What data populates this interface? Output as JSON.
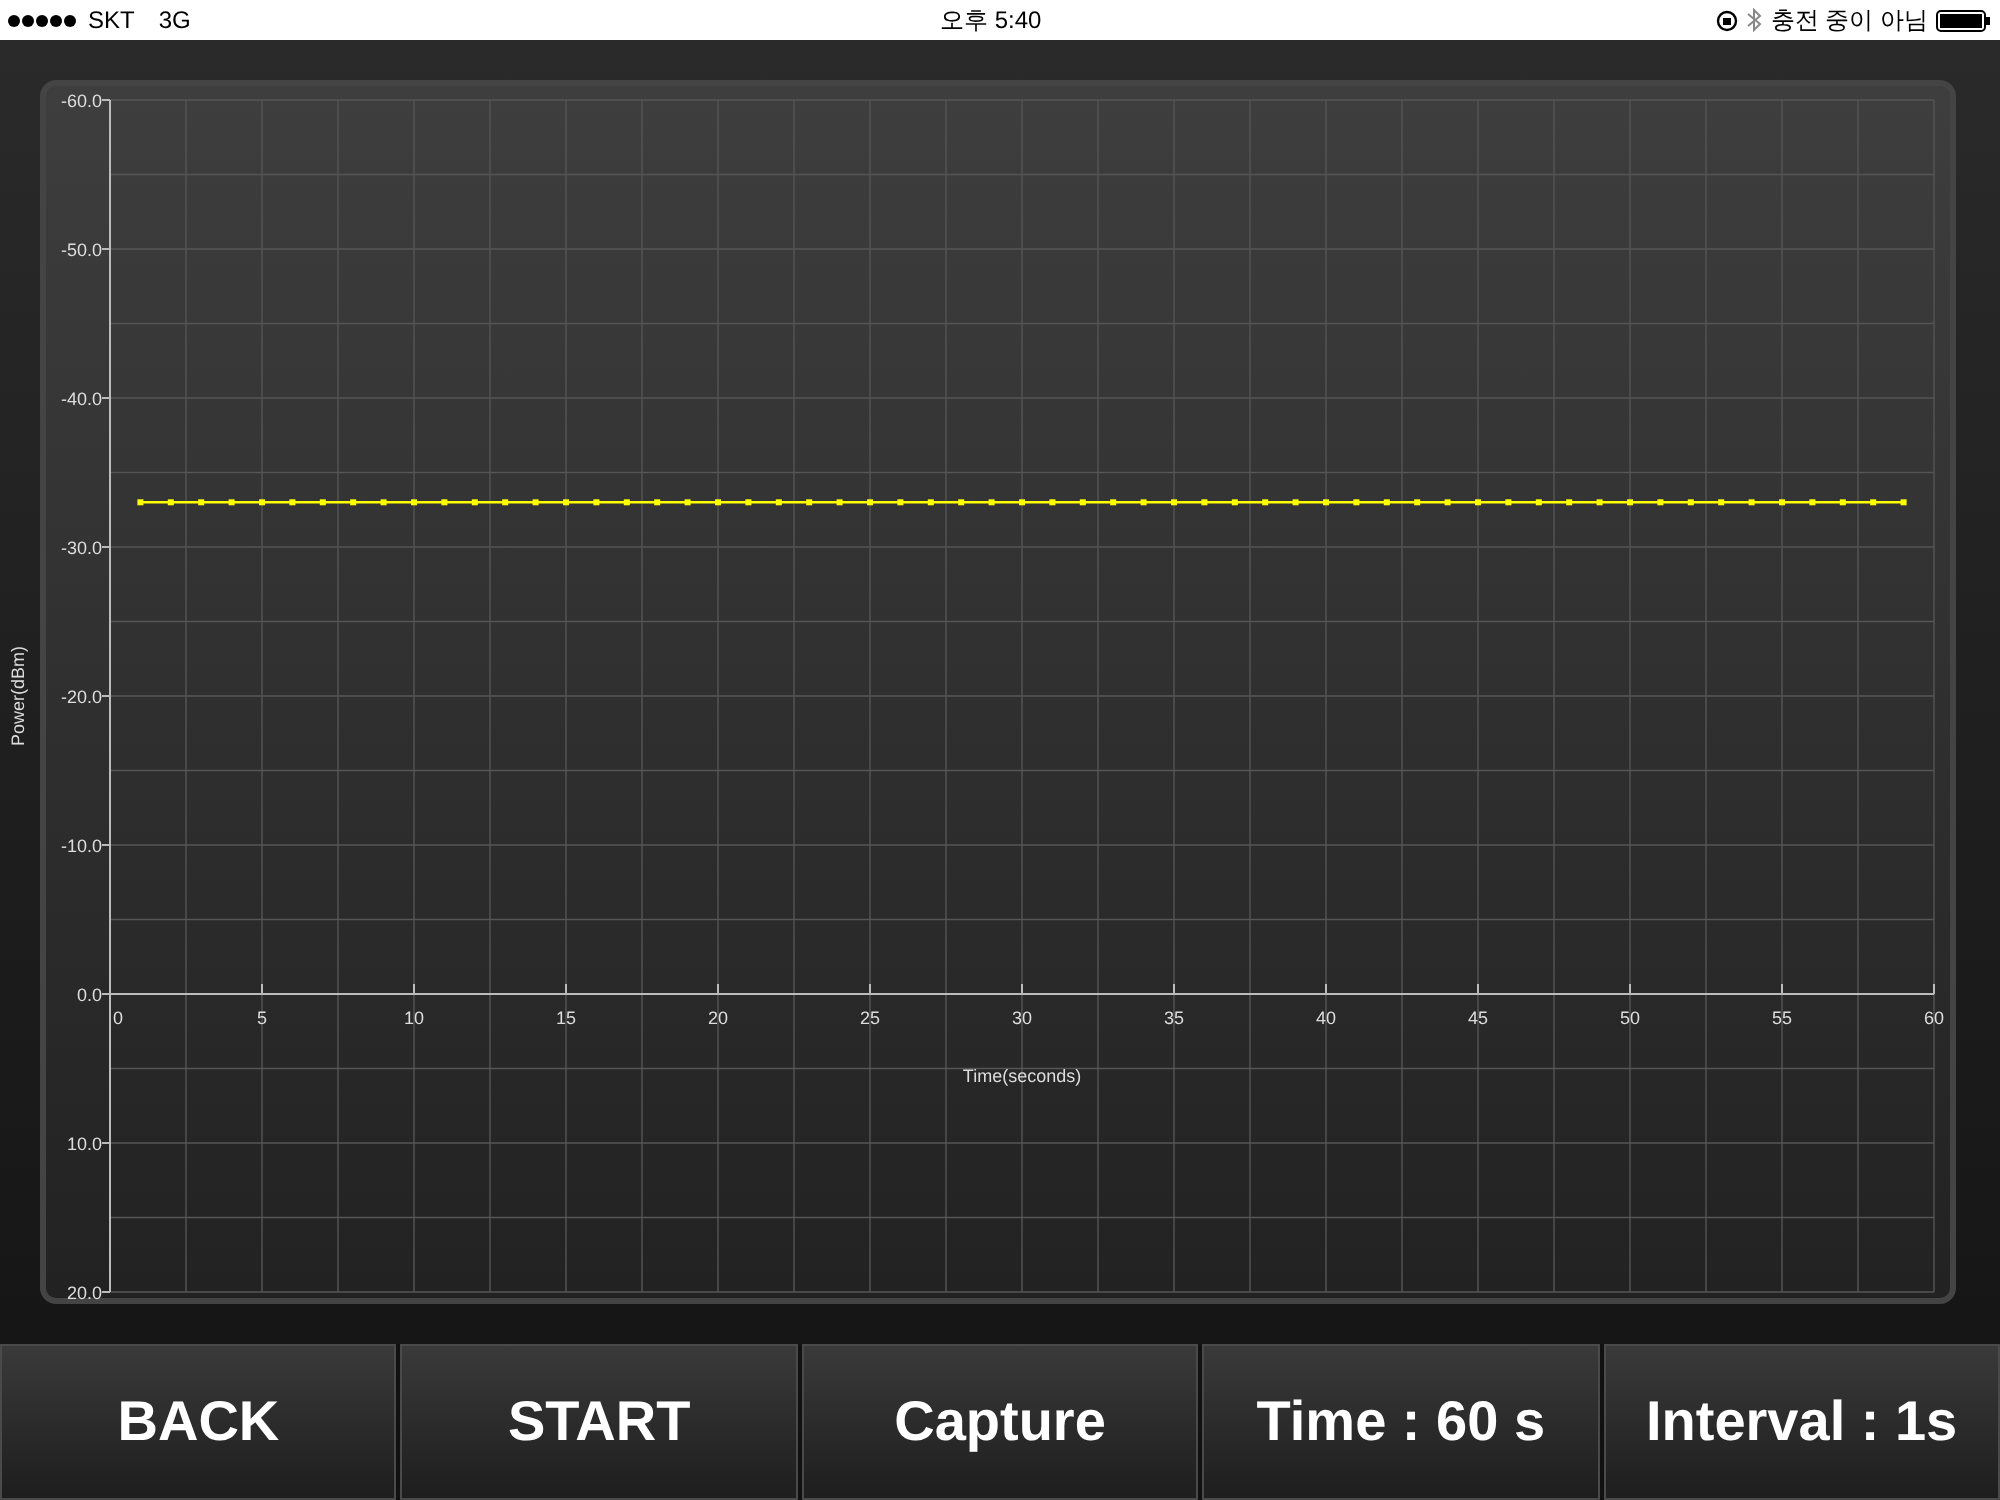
{
  "status_bar": {
    "carrier": "SKT",
    "network": "3G",
    "time": "오후 5:40",
    "charging": "충전 중이 아님"
  },
  "chart": {
    "chart_data": {
      "type": "line",
      "xlabel": "Time(seconds)",
      "ylabel": "Power(dBm)",
      "x": [
        1,
        2,
        3,
        4,
        5,
        6,
        7,
        8,
        9,
        10,
        11,
        12,
        13,
        14,
        15,
        16,
        17,
        18,
        19,
        20,
        21,
        22,
        23,
        24,
        25,
        26,
        27,
        28,
        29,
        30,
        31,
        32,
        33,
        34,
        35,
        36,
        37,
        38,
        39,
        40,
        41,
        42,
        43,
        44,
        45,
        46,
        47,
        48,
        49,
        50,
        51,
        52,
        53,
        54,
        55,
        56,
        57,
        58,
        59
      ],
      "grid": true,
      "series": [
        {
          "color": "#ffff00",
          "marker": "square",
          "values": [
            -33,
            -33,
            -33,
            -33,
            -33,
            -33,
            -33,
            -33,
            -33,
            -33,
            -33,
            -33,
            -33,
            -33,
            -33,
            -33,
            -33,
            -33,
            -33,
            -33,
            -33,
            -33,
            -33,
            -33,
            -33,
            -33,
            -33,
            -33,
            -33,
            -33,
            -33,
            -33,
            -33,
            -33,
            -33,
            -33,
            -33,
            -33,
            -33,
            -33,
            -33,
            -33,
            -33,
            -33,
            -33,
            -33,
            -33,
            -33,
            -33,
            -33,
            -33,
            -33,
            -33,
            -33,
            -33,
            -33,
            -33,
            -33,
            -33
          ]
        }
      ],
      "xlim": [
        0,
        60
      ],
      "ylim": [
        20,
        -60
      ],
      "xticks": [
        0,
        5,
        10,
        15,
        20,
        25,
        30,
        35,
        40,
        45,
        50,
        55,
        60
      ],
      "yticks": [
        {
          "value": -60,
          "label": "-60.0"
        },
        {
          "value": -50,
          "label": "-50.0"
        },
        {
          "value": -40,
          "label": "-40.0"
        },
        {
          "value": -30,
          "label": "-30.0"
        },
        {
          "value": -20,
          "label": "-20.0"
        },
        {
          "value": -10,
          "label": "-10.0"
        },
        {
          "value": 0,
          "label": "0.0"
        },
        {
          "value": 10,
          "label": "10.0"
        },
        {
          "value": 20,
          "label": "20.0"
        }
      ]
    }
  },
  "buttons": [
    "BACK",
    "START",
    "Capture",
    "Time : 60 s",
    "Interval : 1s"
  ]
}
